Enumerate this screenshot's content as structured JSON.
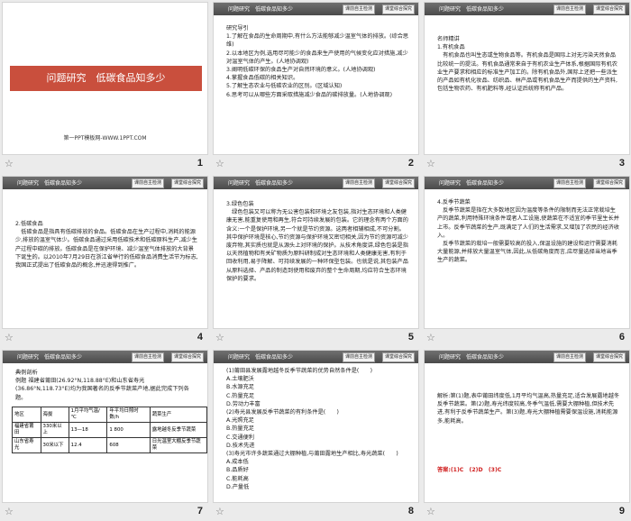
{
  "header": {
    "title": "问题研究　低碳食品知多少",
    "btn_contrast": "课前自主检测",
    "btn_practice": "课堂综合探究"
  },
  "slides": [
    {
      "num": "1",
      "title": "问题研究　低碳食品知多少",
      "site": "第一PPT模板网-WWW.1PPT.COM"
    },
    {
      "num": "2",
      "text": "研究导引\n1.了解在食品的生命周期中,有什么方法能够减少温室气体的排放。(综合思维)\n2.以本地区为例,选用尽可能少的食品来生产使用的气候变化应对措施,减少对温室气体的产生。(人地协调观)\n3.阐明低碳环保的食品生产对自然环境的意义。(人地协调观)\n4.掌握食品低碳的相关知识。\n5.了解生态农业与低碳农业的区别。(区域认知)\n6.思考可以从哪些方面采取措施减少食品的碳排放量。(人地协调观)"
    },
    {
      "num": "3",
      "text": "名师精讲\n1.有机食品\n　有机食品也叫生态或生物食品等。有机食品是国际上对无污染天然食品比较统一的提法。有机食品通常来自于有机农业生产体系,根据国际有机农业生产要求和相应的标准生产加工的。除有机食品外,国际上还把一些派生的产品如有机化妆品、纺织品、林产品或有机食品生产而提供的生产资料,包括生物农药、有机肥料等,经认证后统称有机产品。"
    },
    {
      "num": "4",
      "text": "2.低碳食品\n　低碳食品是指具有低碳排放的食品。低碳食品在生产过程中,消耗的能源少,排放的温室气体少。低碳食品通过采用低碳技术和低碳原料生产,减少生产过程中碳的排放。低碳食品是在保护环境、减少温室气体排放的大背景下诞生的。以2010年7月29日在浙江省举行的低碳食品消费生活节为标志,我国正式提出了低碳食品的概念,并迅速得到推广。"
    },
    {
      "num": "5",
      "text": "3.绿色包装\n　绿色包装又可以称为无公害包装和环境之友包装,指对生态环境和人类健康无害,能重复使用和再生,符合可持续发展的包装。它的理念有两个方面的含义:一个是保护环境,另一个就是节约资源。这两者相辅相成,不可分割。其中保护环境是核心,节约资源与保护环境又密切相关,因为节约资源可减少废弃物,其实质也就是从源头上对环境的保护。从技术角度讲,绿色包装是指以天然植物和有关矿物质为原料研制成对生态环境和人类健康无害,有利于回收利用,易于降解、可持续发展的一种环保型包装。也就是说,其包装产品从原料选择、产品的制造到使用和废弃的整个生命周期,均应符合生态环境保护的要求。"
    },
    {
      "num": "6",
      "text": "4.反季节蔬菜\n　反季节蔬菜是指在大多数地区因为温度等条件的限制而无法正常栽培生产的蔬菜,利用特殊环境条件或者人工设施,使蔬菜在不适宜的季节里生长并上市。反季节蔬菜的生产,既满足了人们的生活需求,又增加了农民的经济收入。\n　反季节蔬菜的栽培一般需要较高的投入,保温设施的建设和运行需要消耗大量能源,并排放大量温室气体,因此,从低碳角度而言,应尽量选择当地当季生产的蔬菜。"
    },
    {
      "num": "7",
      "text": "典例剖析\n例题 福建省莆田(26.92°N,118.88°E)和山东省寿光(36.86°N,118.73°E)均为我国著名的反季节蔬菜产地,据此完成下列各题。",
      "table": {
        "headers": [
          "地区",
          "海拔",
          "1月平均气温/℃",
          "年平均日照时数/h",
          "蔬菜生产"
        ],
        "rows": [
          [
            "福建省莆田",
            "330米以上",
            "13—18",
            "1 800",
            "露地越冬反季节蔬菜"
          ],
          [
            "山东省寿光",
            "30米以下",
            "12.4",
            "608",
            "日光温室大棚反季节蔬菜"
          ]
        ]
      }
    },
    {
      "num": "8",
      "text": "(1)莆田县发展露地越冬反季节蔬菜的优势自然条件是(　　)\nA.土壤肥沃\nB.水源充足\nC.热量充足\nD.劳动力丰富\n(2)寿光县发展反季节蔬菜的有利条件是(　　)\nA.光照充足\nB.热量充足\nC.交通便利\nD.技术先进\n(3)寿光市许多蔬菜通过大棚种植,与莆田露地生产相比,寿光蔬菜(　　)\nA.成本低\nB.品质好\nC.能耗高\nD.产量低"
    },
    {
      "num": "9",
      "text": "解析:第(1)题,表中莆田纬度低,1月平均气温高,热量充足,适合发展露地越冬反季节蔬菜。第(2)题,寿光纬度较高,冬季气温低,需要大棚种植,但技术先进,有利于反季节蔬菜生产。第(3)题,寿光大棚种植需要保温设施,消耗能源多,能耗高。",
      "answer": "答案:(1)C　(2)D　(3)C"
    }
  ]
}
